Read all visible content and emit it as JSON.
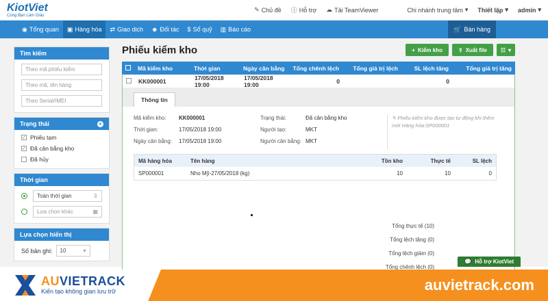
{
  "app": {
    "brand": "KiotViet",
    "slogan": "Cùng Bạn Làm Giàu"
  },
  "top": {
    "theme": "Chủ đề",
    "help": "Hỗ trợ",
    "teamviewer": "Tải TeamViewer",
    "branch": "Chi nhánh trung tâm",
    "settings": "Thiết lập",
    "user": "admin"
  },
  "nav": {
    "items": [
      "Tổng quan",
      "Hàng hóa",
      "Giao dịch",
      "Đối tác",
      "Sổ quỹ",
      "Báo cáo"
    ],
    "sell": "Bán hàng"
  },
  "sidebar": {
    "search_title": "Tìm kiếm",
    "search_placeholders": [
      "Theo mã phiếu kiểm",
      "Theo mã, tên hàng",
      "Theo Serial/IMEI"
    ],
    "status_title": "Trạng thái",
    "status_items": [
      "Phiếu tạm",
      "Đã cân bằng kho",
      "Đã hủy"
    ],
    "time_title": "Thời gian",
    "time_all": "Toàn thời gian",
    "time_other": "Lựa chọn khác",
    "display_title": "Lựa chọn hiển thị",
    "records_label": "Số bản ghi:",
    "records_value": "10"
  },
  "main": {
    "title": "Phiếu kiểm kho",
    "btn_check": "Kiểm kho",
    "btn_export": "Xuất file",
    "columns": [
      "Mã kiểm kho",
      "Thời gian",
      "Ngày cân bằng",
      "Tổng chênh lệch",
      "Tổng giá trị lệch",
      "SL lệch tăng",
      "Tổng giá trị tăng"
    ],
    "row": {
      "code": "KK000001",
      "time": "17/05/2018 19:00",
      "balance_date": "17/05/2018 19:00",
      "total_diff": "0",
      "total_value_diff": "",
      "qty_increase": "0",
      "total_value_increase": ""
    }
  },
  "detail": {
    "tab": "Thông tin",
    "code_label": "Mã kiểm kho:",
    "code": "KK000001",
    "time_label": "Thời gian:",
    "time": "17/05/2018 19:00",
    "balance_label": "Ngày cân bằng:",
    "balance": "17/05/2018 19:00",
    "status_label": "Trạng thái:",
    "status": "Đã cân bằng kho",
    "creator_label": "Người tạo:",
    "creator": "MKT",
    "balancer_label": "Người cân bằng:",
    "balancer": "MKT",
    "note": "Phiếu kiểm kho được tạo tự động khi thêm mới Hàng hóa:SP000001",
    "columns": [
      "Mã hàng hóa",
      "Tên hàng",
      "Tồn kho",
      "Thực tế",
      "SL lệch"
    ],
    "items": [
      {
        "code": "SP000001",
        "name": "Nho Mỹ-27/05/2018 (kg)",
        "stock": "10",
        "actual": "10",
        "diff": "0"
      }
    ],
    "totals": [
      "Tổng thực tế (10)",
      "Tổng lệch tăng (0)",
      "Tổng lệch giảm (0)",
      "Tổng chênh lệch (0)"
    ]
  },
  "support": "Hỗ trợ KiotViet",
  "banner": {
    "name_a": "AU",
    "name_b": "VIETRACK",
    "tagline": "Kiến tạo không gian lưu trữ",
    "site": "auvietrack.com"
  },
  "colors": {
    "primary": "#2f88d0",
    "green": "#43a047",
    "orange": "#f5901f",
    "navy": "#1b4e9b"
  }
}
